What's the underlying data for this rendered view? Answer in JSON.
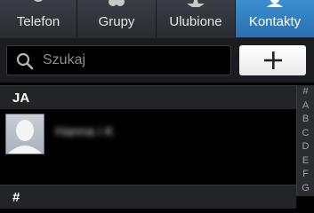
{
  "tabs": [
    {
      "label": "Telefon",
      "icon": "phone-icon",
      "active": false
    },
    {
      "label": "Grupy",
      "icon": "group-icon",
      "active": false
    },
    {
      "label": "Ulubione",
      "icon": "star-icon",
      "active": false
    },
    {
      "label": "Kontakty",
      "icon": "contact-icon",
      "active": true
    }
  ],
  "search": {
    "placeholder": "Szukaj",
    "icon": "search-icon"
  },
  "add_button": {
    "icon": "plus-icon"
  },
  "sections": [
    {
      "header": "JA"
    },
    {
      "header": "#"
    }
  ],
  "contacts": [
    {
      "name": "Hanna i K",
      "avatar": "default-avatar"
    }
  ],
  "index_letters": [
    "#",
    "A",
    "B",
    "C",
    "D",
    "E",
    "F",
    "G"
  ],
  "colors": {
    "accent": "#2f7fc1",
    "background": "#000000",
    "header_bg": "#232428"
  }
}
